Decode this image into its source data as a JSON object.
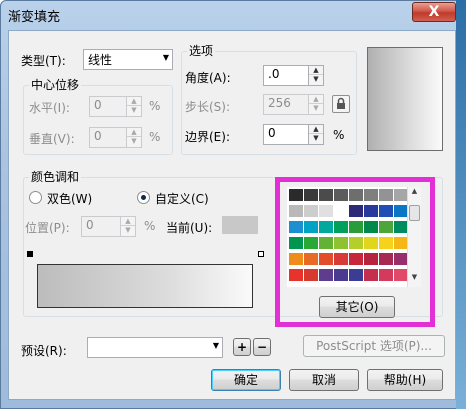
{
  "window": {
    "title": "渐变填充",
    "close_glyph": "X"
  },
  "type_label": "类型(T):",
  "type_value": "线性",
  "options": {
    "group_label": "选项",
    "angle_label": "角度(A):",
    "angle_value": ".0",
    "steps_label": "步长(S):",
    "steps_value": "256",
    "edge_label": "边界(E):",
    "edge_value": "0",
    "edge_unit": "%"
  },
  "center": {
    "group_label": "中心位移",
    "h_label": "水平(I):",
    "h_value": "0",
    "h_unit": "%",
    "v_label": "垂直(V):",
    "v_value": "0",
    "v_unit": "%"
  },
  "blend": {
    "group_label": "颜色调和",
    "two_color_label": "双色(W)",
    "custom_label": "自定义(C)",
    "selected": "custom",
    "position_label": "位置(P):",
    "position_value": "0",
    "position_unit": "%",
    "current_label": "当前(U):"
  },
  "palette": {
    "rows": [
      [
        "#2b2b2b",
        "#3a3a3a",
        "#4b4b4b",
        "#5c5c5c",
        "#6e6e6e",
        "#7f7f7f",
        "#939393",
        "#a6a6a6"
      ],
      [
        "#b9b9b9",
        "#cdcdcd",
        "#e0e0e0",
        "#ffffff",
        "#2e2a7a",
        "#2a3a9c",
        "#1f4fb5",
        "#0a77c4"
      ],
      [
        "#1c8fd0",
        "#00a3c4",
        "#00a89e",
        "#00a05a",
        "#2a9d3a",
        "#00894a",
        "#4ea53a",
        "#008c5e"
      ],
      [
        "#00964f",
        "#2aa836",
        "#63b236",
        "#8fc231",
        "#b5cf2a",
        "#e1d51e",
        "#f6d21c",
        "#f5b715"
      ],
      [
        "#ef8d1b",
        "#e86b23",
        "#e24e2c",
        "#d83a37",
        "#c6273a",
        "#b6233d",
        "#a72a52",
        "#962f6a"
      ],
      [
        "#e8322c",
        "#d8392f",
        "#5e3c8e",
        "#4a3b90",
        "#3a3d93",
        "#c52f4e",
        "#d5395b",
        "#e04a68"
      ]
    ],
    "other_button": "其它(O)",
    "highlight_color": "#e22fd6"
  },
  "preset_label": "预设(R):",
  "preset_value": "",
  "add_preset": "+",
  "remove_preset": "−",
  "postscript_button": "PostScript 选项(P)...",
  "ok_button": "确定",
  "cancel_button": "取消",
  "help_button": "帮助(H)",
  "current_color": "#c8c8c8"
}
